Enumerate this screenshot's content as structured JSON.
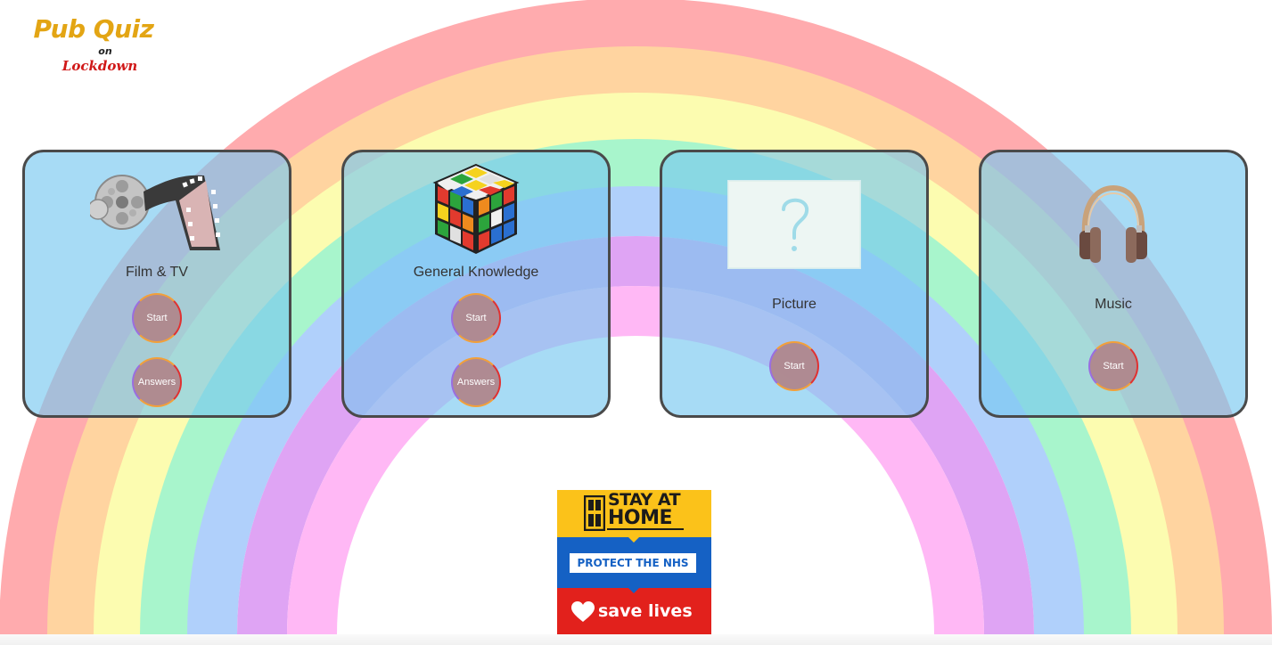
{
  "logo": {
    "title": "Pub Quiz",
    "on": "on",
    "subtitle": "Lockdown"
  },
  "quizzes": [
    {
      "label": "Film & TV",
      "icon": "film-reel-icon",
      "buttons": [
        "Start",
        "Answers"
      ]
    },
    {
      "label": "General Knowledge",
      "icon": "rubiks-cube-icon",
      "buttons": [
        "Start",
        "Answers"
      ]
    },
    {
      "label": "Picture",
      "icon": "question-mark-picture-icon",
      "buttons": [
        "Start"
      ]
    },
    {
      "label": "Music",
      "icon": "headphones-icon",
      "buttons": [
        "Start"
      ]
    }
  ],
  "banner": {
    "line1": "STAY AT",
    "line2": "HOME",
    "protect": "PROTECT THE NHS",
    "save": "save lives"
  },
  "colors": {
    "rainbow": [
      "#ffabae",
      "#ffd4a0",
      "#fcfcb0",
      "#a8f5cc",
      "#b0d0fb",
      "#dfa4f4",
      "#ffb8f5"
    ],
    "card_fill": "#78c8f0",
    "logo_yellow": "#e3a514",
    "logo_red": "#d01818"
  }
}
